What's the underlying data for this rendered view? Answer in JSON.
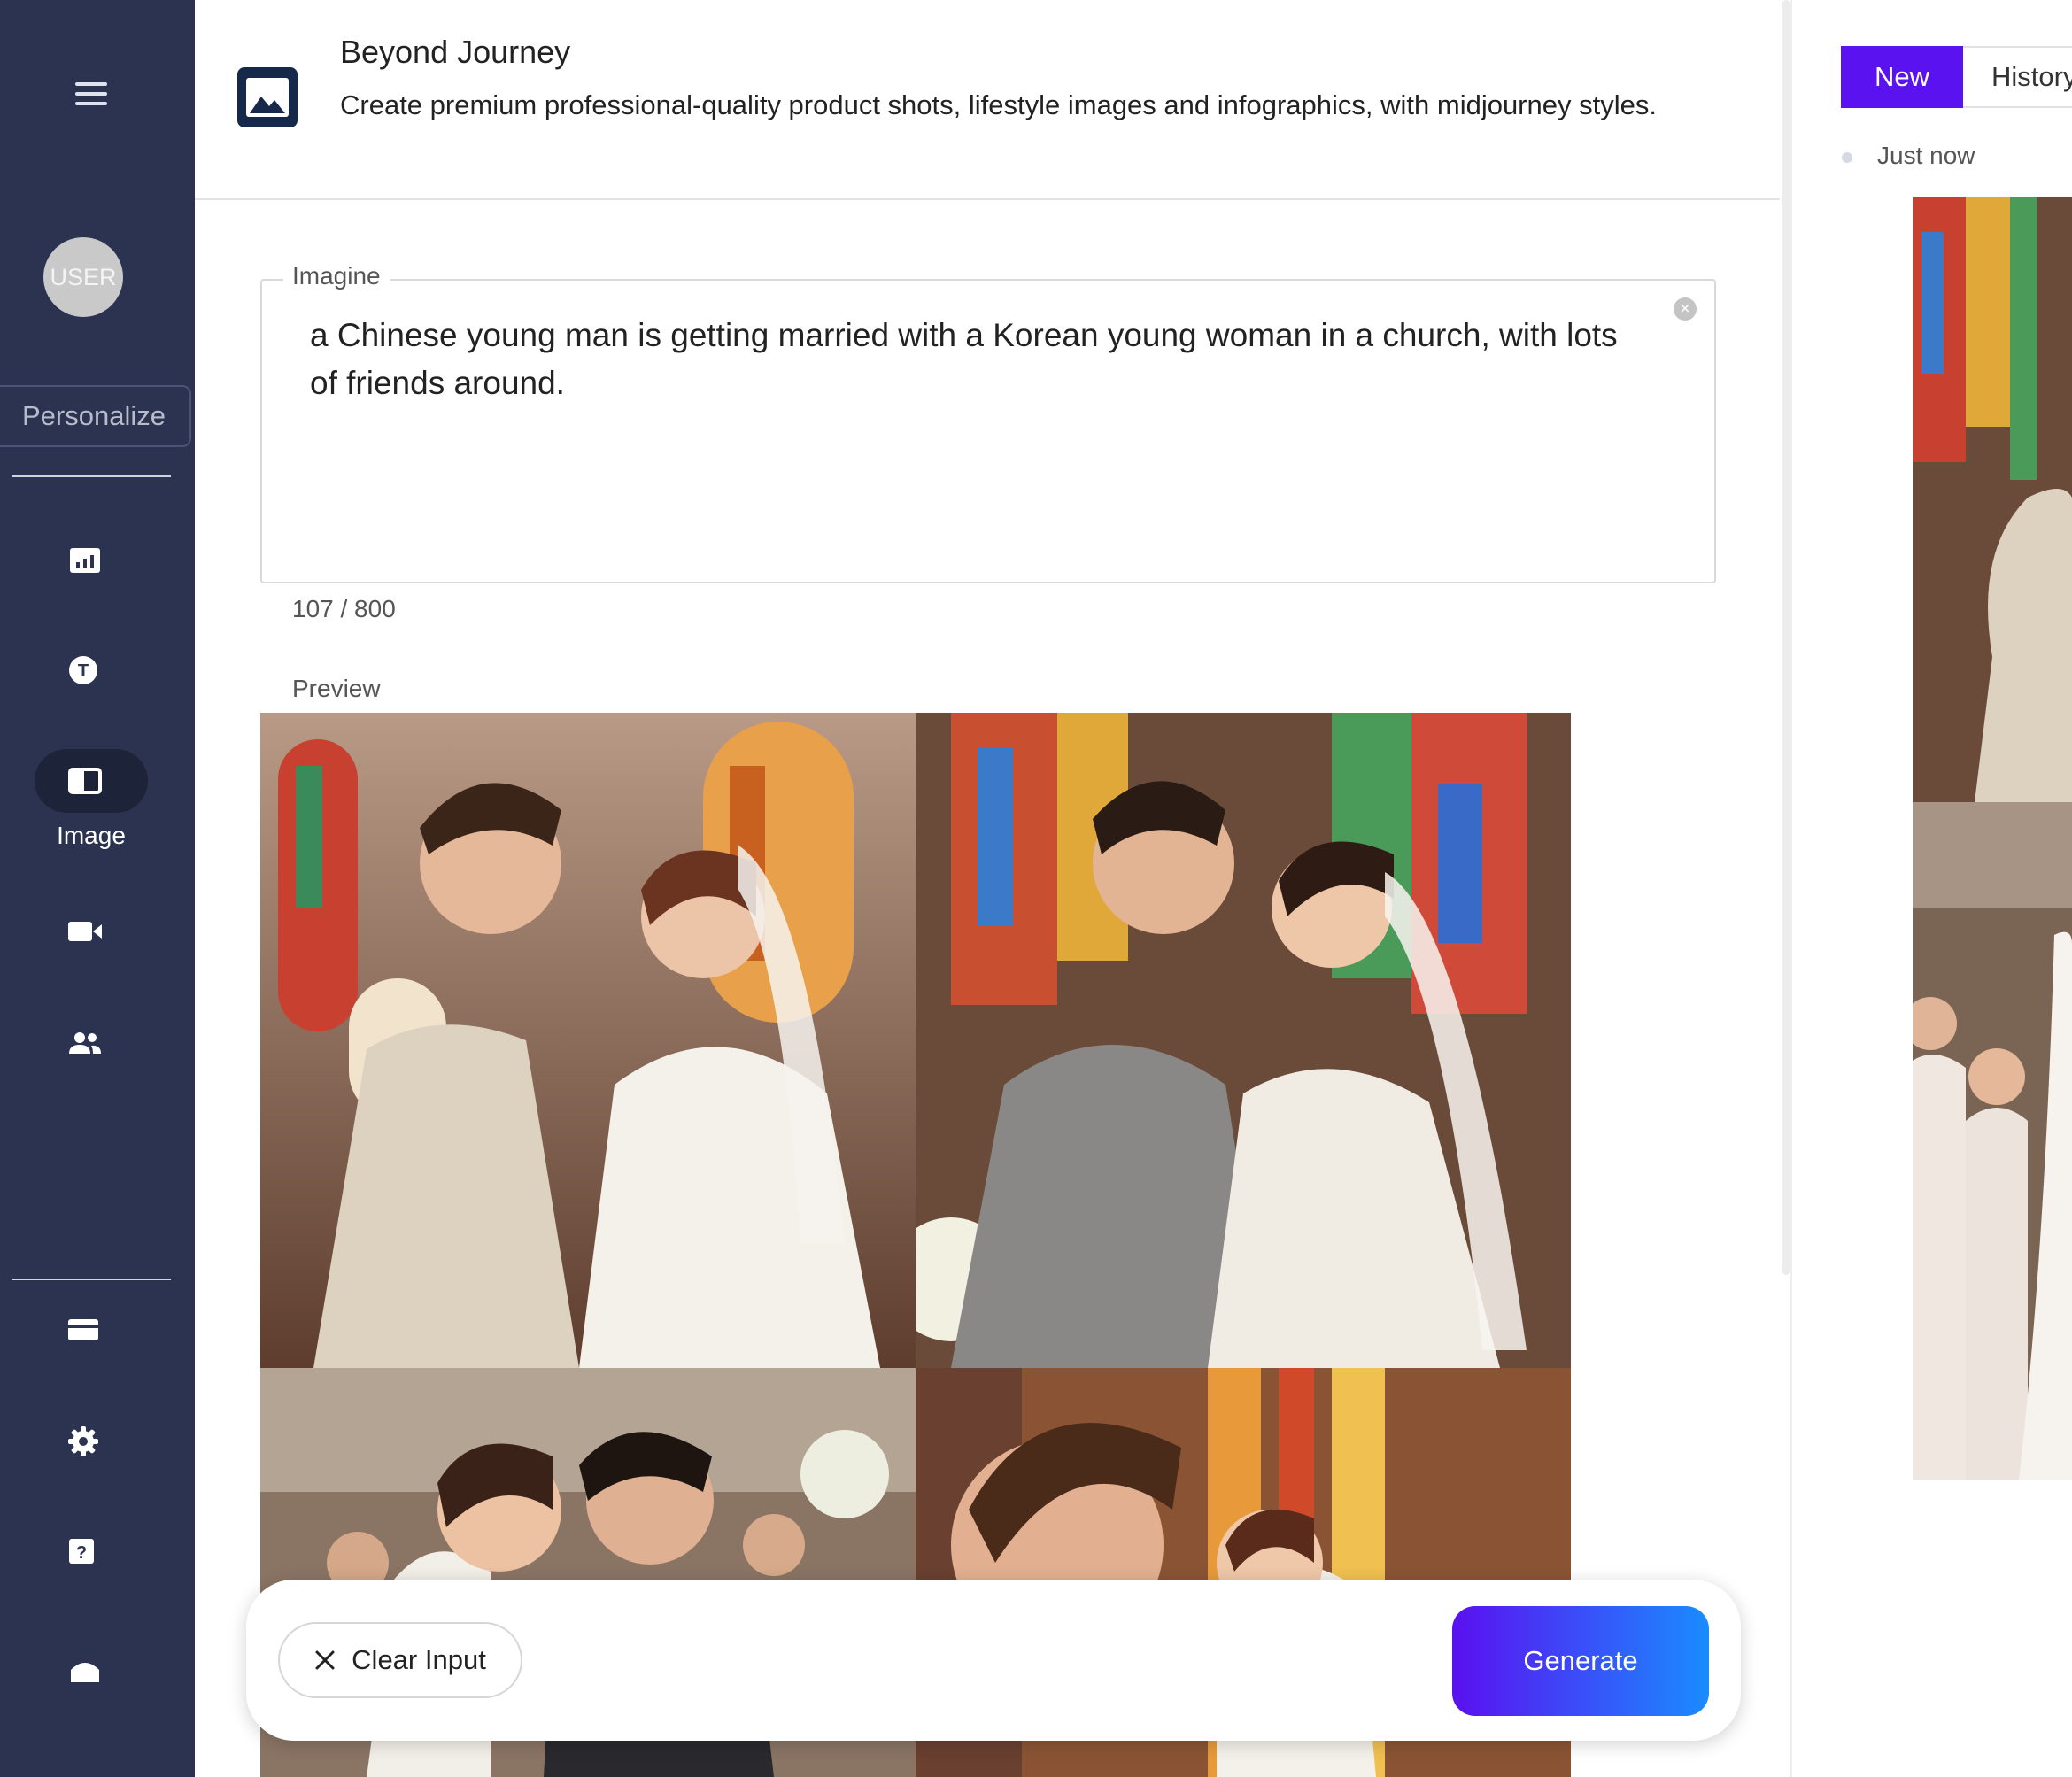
{
  "sidebar": {
    "avatar_label": "USER",
    "personalize_label": "Personalize",
    "nav": [
      {
        "icon": "chart-icon"
      },
      {
        "icon": "text-icon"
      },
      {
        "icon": "image-icon",
        "label": "Image",
        "active": true
      },
      {
        "icon": "video-icon"
      },
      {
        "icon": "people-icon"
      }
    ],
    "bottom_nav": [
      {
        "icon": "credit-card-icon"
      },
      {
        "icon": "gear-icon"
      },
      {
        "icon": "help-icon"
      },
      {
        "icon": "home-icon"
      }
    ]
  },
  "header": {
    "title": "Beyond Journey",
    "description": "Create premium professional-quality product shots, lifestyle images and infographics, with midjourney styles."
  },
  "prompt": {
    "label": "Imagine",
    "value": "a Chinese young man is getting married with a Korean young woman in a church, with lots of friends around.",
    "counter": "107 / 800"
  },
  "preview": {
    "label": "Preview"
  },
  "actions": {
    "clear_label": "Clear Input",
    "generate_label": "Generate"
  },
  "history_panel": {
    "tab_new": "New",
    "tab_history": "History",
    "entry_time": "Just now"
  },
  "colors": {
    "sidebar_bg": "#2b3350",
    "accent": "#5a12f0",
    "generate_gradient_end": "#1a8cff"
  }
}
